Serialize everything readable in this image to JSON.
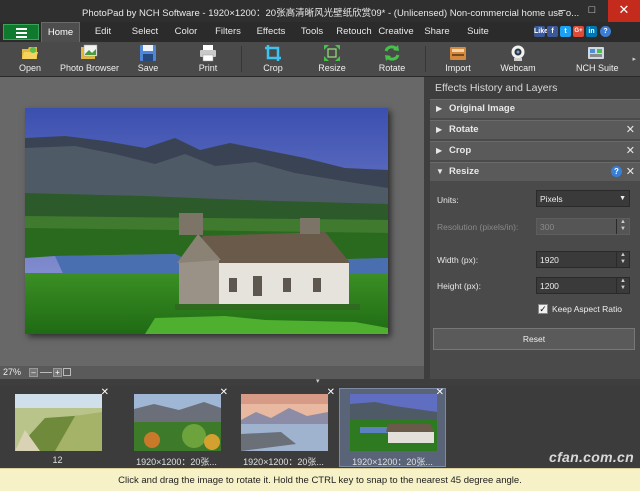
{
  "window": {
    "title": "PhotoPad by NCH Software - 1920×1200：20张高清晰风光壁纸欣赏09* - (Unlicensed) Non-commercial home use o...",
    "minimize": "–",
    "maximize": "□",
    "close": "✕"
  },
  "menu": {
    "tabs": [
      "Home",
      "Edit",
      "Select",
      "Color",
      "Filters",
      "Effects",
      "Tools",
      "Retouch",
      "Creative",
      "Share",
      "Suite"
    ],
    "active": "Home",
    "social": [
      "Like",
      "f",
      "t",
      "G+",
      "in",
      "?"
    ]
  },
  "toolbar": {
    "items": [
      {
        "label": "Open",
        "icon": "open-folder-icon"
      },
      {
        "label": "Photo Browser",
        "icon": "photo-browser-icon"
      },
      {
        "label": "Save",
        "icon": "save-disk-icon"
      },
      {
        "label": "Print",
        "icon": "printer-icon"
      },
      {
        "label": "Crop",
        "icon": "crop-icon"
      },
      {
        "label": "Resize",
        "icon": "resize-icon"
      },
      {
        "label": "Rotate",
        "icon": "rotate-icon"
      },
      {
        "label": "Import",
        "icon": "import-icon"
      },
      {
        "label": "Webcam",
        "icon": "webcam-icon"
      },
      {
        "label": "NCH Suite",
        "icon": "nch-suite-icon"
      }
    ]
  },
  "canvas": {
    "zoom": "27%",
    "zoom_out": "–",
    "zoom_in": "+"
  },
  "panel": {
    "title": "Effects History and Layers",
    "sections": [
      {
        "label": "Original Image",
        "closable": false,
        "expanded": false
      },
      {
        "label": "Rotate",
        "closable": true,
        "expanded": false
      },
      {
        "label": "Crop",
        "closable": true,
        "expanded": false
      },
      {
        "label": "Resize",
        "closable": true,
        "expanded": true
      }
    ],
    "resize": {
      "units_label": "Units:",
      "units_value": "Pixels",
      "resolution_label": "Resolution (pixels/in):",
      "resolution_value": "300",
      "width_label": "Width (px):",
      "width_value": "1920",
      "height_label": "Height (px):",
      "height_value": "1200",
      "keep_aspect_label": "Keep Aspect Ratio",
      "keep_aspect_checked": true,
      "reset_label": "Reset",
      "help": "?"
    }
  },
  "filmstrip": {
    "thumbs": [
      {
        "caption": "12",
        "selected": false
      },
      {
        "caption": "1920×1200：20张...",
        "selected": false
      },
      {
        "caption": "1920×1200：20张...",
        "selected": false
      },
      {
        "caption": "1920×1200：20张...",
        "selected": true
      }
    ]
  },
  "status": {
    "text": "Click and drag the image to rotate it. Hold the CTRL key to snap to the nearest 45 degree angle."
  },
  "watermark": "cfan.com.cn",
  "colors": {
    "accent_green": "#0f7a2d",
    "status_bg": "#f6f1c6",
    "close_red": "#c42b1c"
  }
}
